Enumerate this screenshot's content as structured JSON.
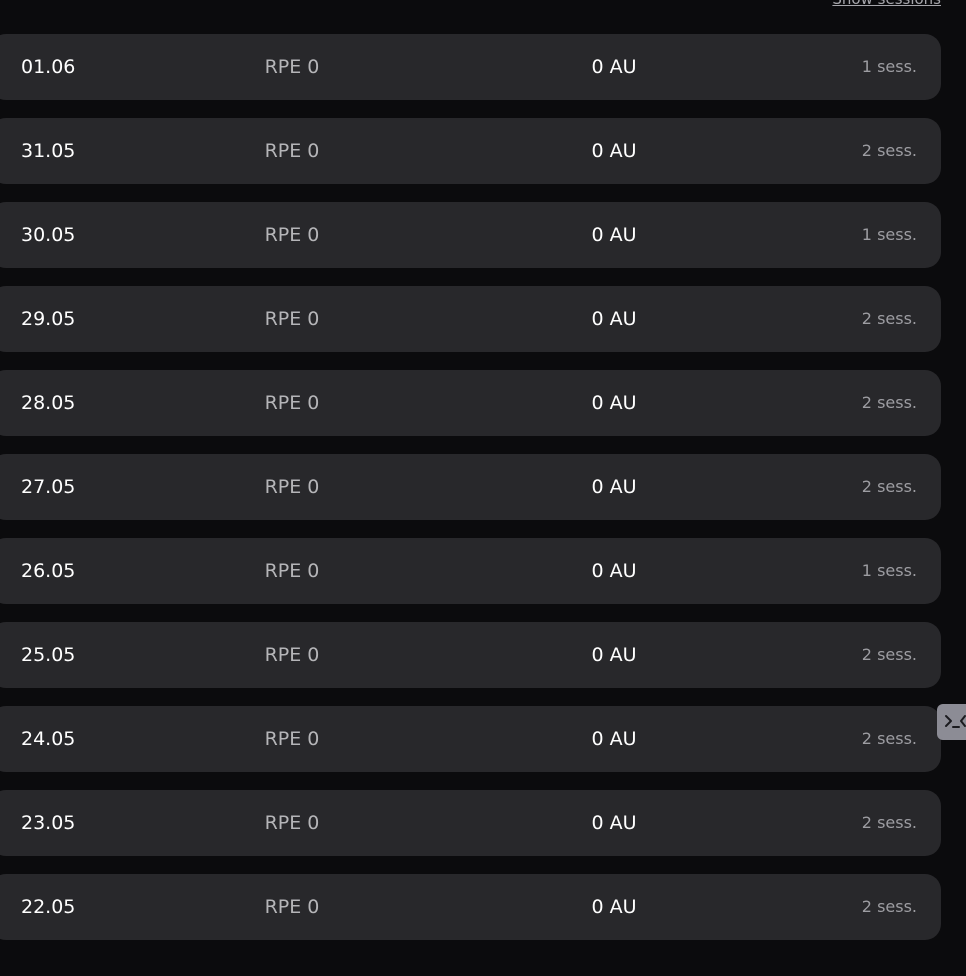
{
  "header": {
    "show_sessions_label": "Show sessions"
  },
  "days": [
    {
      "date": "01.06",
      "rpe": "RPE 0",
      "load": "0 AU",
      "sessions": "1 sess."
    },
    {
      "date": "31.05",
      "rpe": "RPE 0",
      "load": "0 AU",
      "sessions": "2 sess."
    },
    {
      "date": "30.05",
      "rpe": "RPE 0",
      "load": "0 AU",
      "sessions": "1 sess."
    },
    {
      "date": "29.05",
      "rpe": "RPE 0",
      "load": "0 AU",
      "sessions": "2 sess."
    },
    {
      "date": "28.05",
      "rpe": "RPE 0",
      "load": "0 AU",
      "sessions": "2 sess."
    },
    {
      "date": "27.05",
      "rpe": "RPE 0",
      "load": "0 AU",
      "sessions": "2 sess."
    },
    {
      "date": "26.05",
      "rpe": "RPE 0",
      "load": "0 AU",
      "sessions": "1 sess."
    },
    {
      "date": "25.05",
      "rpe": "RPE 0",
      "load": "0 AU",
      "sessions": "2 sess."
    },
    {
      "date": "24.05",
      "rpe": "RPE 0",
      "load": "0 AU",
      "sessions": "2 sess."
    },
    {
      "date": "23.05",
      "rpe": "RPE 0",
      "load": "0 AU",
      "sessions": "2 sess."
    },
    {
      "date": "22.05",
      "rpe": "RPE 0",
      "load": "0 AU",
      "sessions": "2 sess."
    }
  ],
  "side_tab": {
    "icon": "terminal-icon"
  },
  "colors": {
    "background": "#0b0b0d",
    "row": "#28282b"
  }
}
